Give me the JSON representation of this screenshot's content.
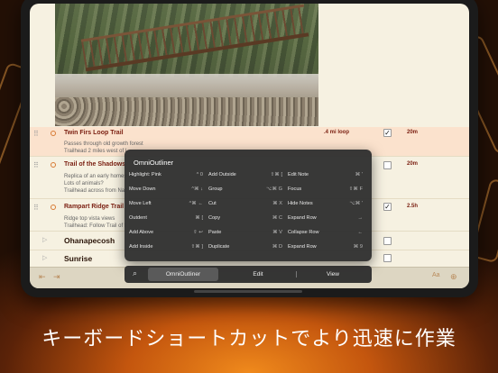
{
  "caption": "キーボードショートカットでより迅速に作業",
  "outline": {
    "rows": [
      {
        "title": "Twin Firs Loop Trail",
        "note1": "Passes through old growth forest",
        "note2": "Trailhead 2 miles west of L",
        "distance": ".4 mi loop",
        "checked": true,
        "time": "20m"
      },
      {
        "title": "Trail of the Shadows",
        "note1": "Replica of an early homes",
        "note2": "Lots of animals?",
        "note3": "Trailhead across from Nat",
        "distance": "",
        "checked": false,
        "time": "20m"
      },
      {
        "title": "Rampart Ridge Trail",
        "note1": "Ridge top vista views",
        "note2": "Trailhead: Follow Trail of t",
        "distance": "",
        "checked": true,
        "time": "2.5h"
      }
    ],
    "groups": [
      "Ohanapecosh",
      "Sunrise"
    ]
  },
  "hud": {
    "title": "OmniOutliner",
    "commands": [
      [
        {
          "label": "Highlight: Pink",
          "key": "^ 0"
        },
        {
          "label": "Add Outside",
          "key": "⇧⌘ ["
        },
        {
          "label": "Edit Note",
          "key": "⌘ '"
        }
      ],
      [
        {
          "label": "Move Down",
          "key": "^⌘ ↓"
        },
        {
          "label": "Group",
          "key": "⌥⌘ G"
        },
        {
          "label": "Focus",
          "key": "⇧⌘ F"
        }
      ],
      [
        {
          "label": "Move Left",
          "key": "^⌘ ←"
        },
        {
          "label": "Cut",
          "key": "⌘ X"
        },
        {
          "label": "Hide Notes",
          "key": "⌥⌘ '"
        }
      ],
      [
        {
          "label": "Outdent",
          "key": "⌘ ["
        },
        {
          "label": "Copy",
          "key": "⌘ C"
        },
        {
          "label": "Expand Row",
          "key": "→"
        }
      ],
      [
        {
          "label": "Add Above",
          "key": "⇧ ↩"
        },
        {
          "label": "Paste",
          "key": "⌘ V"
        },
        {
          "label": "Collapse Row",
          "key": "←"
        }
      ],
      [
        {
          "label": "Add Inside",
          "key": "⇧⌘ ]"
        },
        {
          "label": "Duplicate",
          "key": "⌘ D"
        },
        {
          "label": "Expand Row",
          "key": "⌘ 9"
        }
      ]
    ],
    "tabs": [
      "OmniOutliner",
      "Edit",
      "View"
    ],
    "search_icon": "search-icon"
  },
  "colors": {
    "accent": "#7a1e10",
    "selection": "#fbe2cd",
    "bullet": "#d87a33",
    "hud": "#303030"
  }
}
